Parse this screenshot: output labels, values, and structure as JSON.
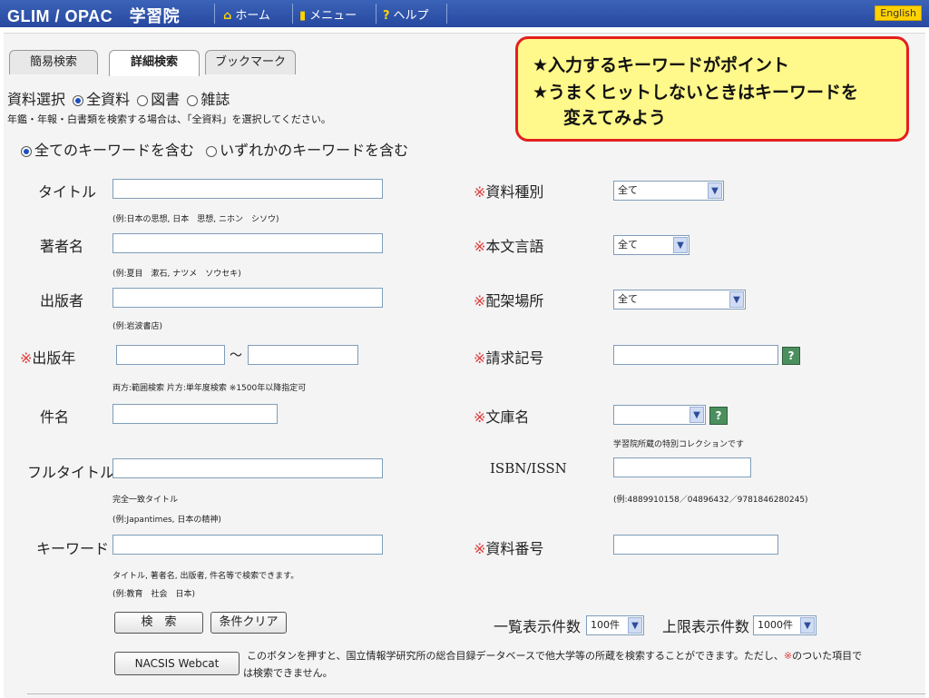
{
  "topbar": {
    "brand": "GLIM / OPAC　学習院",
    "home": "ホーム",
    "menu": "メニュー",
    "help": "ヘルプ",
    "lang": "English"
  },
  "tabs": [
    "簡易検索",
    "詳細検索",
    "ブックマーク"
  ],
  "material": {
    "label": "資料選択",
    "options": [
      "全資料",
      "図書",
      "雑誌"
    ],
    "note": "年鑑・年報・白書類を検索する場合は、「全資料」を選択してください。"
  },
  "keyword_mode": [
    "全てのキーワードを含む",
    "いずれかのキーワードを含む"
  ],
  "left_fields": {
    "title": {
      "label": "タイトル",
      "hint": "(例:日本の思想, 日本　思想, ニホン　シソウ)"
    },
    "author": {
      "label": "著者名",
      "hint": "(例:夏目　漱石, ナツメ　ソウセキ)"
    },
    "publisher": {
      "label": "出版者",
      "hint": "(例:岩波書店)"
    },
    "year": {
      "mark": "※",
      "label": "出版年",
      "tilde": "～",
      "hint": "両方:範囲検索 片方:単年度検索 ※1500年以降指定可"
    },
    "subject": {
      "label": "件名"
    },
    "fulltitle": {
      "label": "フルタイトル",
      "hint1": "完全一致タイトル",
      "hint2": "(例:Japantimes, 日本の精神)"
    },
    "keyword": {
      "label": "キーワード",
      "hint1": "タイトル, 著者名, 出版者, 件名等で検索できます。",
      "hint2": "(例:教育　社会　日本)"
    }
  },
  "right_fields": {
    "mark": "※",
    "type": {
      "label": "資料種別",
      "value": "全て"
    },
    "language": {
      "label": "本文言語",
      "value": "全て"
    },
    "location": {
      "label": "配架場所",
      "value": "全て"
    },
    "callno": {
      "label": "請求記号",
      "help": "?"
    },
    "collection": {
      "label": "文庫名",
      "help": "?",
      "hint": "学習院所蔵の特別コレクションです"
    },
    "isbn": {
      "label": "ISBN/ISSN",
      "hint": "(例:4889910158／04896432／9781846280245)"
    },
    "itemno": {
      "label": "資料番号"
    }
  },
  "buttons": {
    "search": "検　索",
    "clear": "条件クリア",
    "nacsis": "NACSIS Webcat"
  },
  "display": {
    "list_label": "一覧表示件数",
    "list_value": "100件",
    "limit_label": "上限表示件数",
    "limit_value": "1000件"
  },
  "nacsis_note": {
    "line1_a": "このボタンを押すと、国立情報学研究所の総合目録データベースで他大学等の所蔵を検索することができます。ただし、",
    "line1_mark": "※",
    "line1_b": "のついた項目で",
    "line2": "は検索できません。"
  },
  "callout": {
    "line1": "★入力するキーワードがポイント",
    "line2": "★うまくヒットしないときはキーワードを",
    "line3": "変えてみよう"
  },
  "colors": {
    "topbar": "#2f56ad",
    "callout_bg": "#fff88a",
    "callout_border": "#e41f1f",
    "mark": "#e03a3a"
  }
}
